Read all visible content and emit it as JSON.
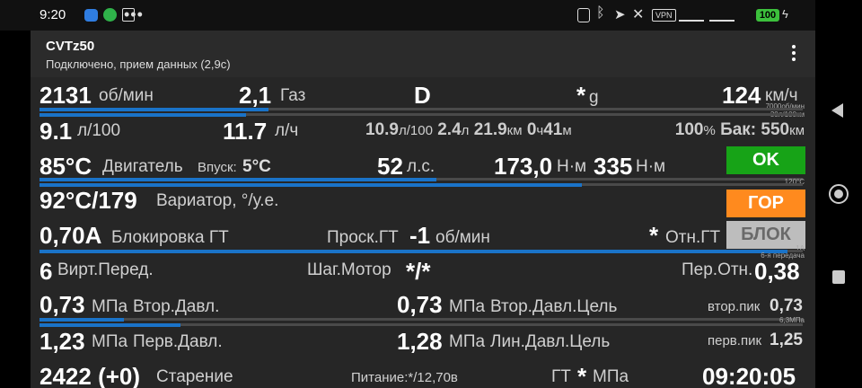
{
  "status_bar": {
    "time": "9:20",
    "right_icons": [
      "nfc-icon",
      "bluetooth-icon",
      "wifi-off-icon",
      "vpn-icon"
    ],
    "vpn_label": "VPN",
    "battery": "100"
  },
  "app_bar": {
    "title": "CVTz50",
    "subtitle": "Подключено, прием данных (2,9с)"
  },
  "colors": {
    "bar_blue": "#1a73c8",
    "ok_green": "#17a317",
    "hot_orange": "#ff8a1e",
    "block_gray": "#bdbdbd"
  },
  "rows": {
    "r1": {
      "rpm": "2131",
      "rpm_unit": "об/мин",
      "throttle": "2,1",
      "throttle_label": "Газ",
      "gear": "D",
      "g_star": "*",
      "g_unit": "g",
      "speed": "124",
      "speed_unit": "км/ч",
      "scale_rpm": "7000об/мин",
      "scale_cons": "30л/100км",
      "rpm_fraction": 0.3,
      "throttle_fraction": 0.27
    },
    "r2": {
      "cons": "9.1",
      "cons_unit": "л/100",
      "flow": "11.7",
      "flow_unit": "л/ч",
      "avg": "10.9",
      "avg_unit": "л/100",
      "used": "2.4",
      "used_unit": "л",
      "dist": "21.9",
      "dist_unit": "км",
      "hours": "0",
      "hours_unit": "ч",
      "mins": "41",
      "mins_unit": "м",
      "fuel_pct": "100",
      "fuel_pct_unit": "%",
      "tank_label": "Бак:",
      "range": "550",
      "range_unit": "км"
    },
    "r3": {
      "eng_temp": "85°C",
      "eng_label": "Двигатель",
      "intake_label": "Впуск:",
      "intake": "5°C",
      "power": "52",
      "power_unit": "л.с.",
      "torque1": "173,0",
      "torque_unit": "Н·м",
      "torque2": "335",
      "torque2_unit": "Н·м",
      "ok_label": "OK",
      "scale_temp": "120°C",
      "torque_fraction": 0.52,
      "temp_fraction": 0.71
    },
    "r4": {
      "cvt_temp": "92°C/179",
      "cvt_label": "Вариатор, °/у.е.",
      "hot_label": "ГОР"
    },
    "r5": {
      "lock_current": "0,70A",
      "lock_label": "Блокировка ГТ",
      "slip_label": "Проск.ГТ",
      "slip": "-1",
      "slip_unit": "об/мин",
      "rel_star": "*",
      "rel_label": "Отн.ГТ",
      "block_label": "БЛОК",
      "scale_gear": "6-я передача",
      "scale_a": "1А",
      "lock_fraction": 0.98
    },
    "r6": {
      "virt_gear": "6",
      "virt_label": "Вирт.Перед.",
      "stepper_label": "Шаг.Мотор",
      "stepper": "*/*",
      "ratio_label": "Пер.Отн.",
      "ratio": "0,38"
    },
    "r7": {
      "sec_press": "0,73",
      "sec_unit": "МПа",
      "sec_label": "Втор.Давл.",
      "sec_target": "0,73",
      "sec_target_unit": "МПа",
      "sec_target_label": "Втор.Давл.Цель",
      "sec_peak_label": "втор.пик",
      "sec_peak": "0,73",
      "scale_press": "6,3МПа",
      "sec_fraction": 0.11,
      "sec_target_fraction": 0.185
    },
    "r8": {
      "pri_press": "1,23",
      "pri_unit": "МПа",
      "pri_label": "Перв.Давл.",
      "line_target": "1,28",
      "line_unit": "МПа",
      "line_label": "Лин.Давл.Цель",
      "pri_peak_label": "перв.пик",
      "pri_peak": "1,25"
    },
    "r9": {
      "aging": "2422 (+0)",
      "aging_label": "Старение",
      "power_label": "Питание:*/12,70в",
      "gt_label": "ГТ",
      "gt_star": "*",
      "gt_unit": "МПа",
      "clock": "09:20:05"
    }
  }
}
